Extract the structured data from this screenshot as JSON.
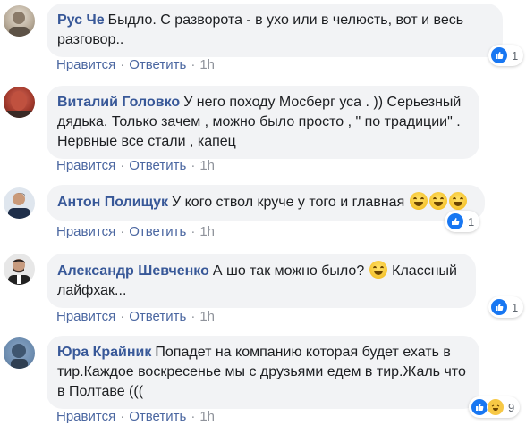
{
  "comments": [
    {
      "author": "Рус Че",
      "text": "Быдло. С разворота - в ухо или в челюсть, вот и весь разговор..",
      "time": "1h",
      "reactions": "1"
    },
    {
      "author": "Виталий Головко",
      "text": "У него походу Мосберг уса . )) Серьезный дядька. Только зачем , можно было просто , \" по традиции\" . Нервные все стали , капец",
      "time": "1h",
      "reactions": ""
    },
    {
      "author": "Антон Полищук",
      "text": "У кого ствол круче у того и главная",
      "time": "1h",
      "reactions": "1"
    },
    {
      "author": "Александр Шевченко",
      "text": "А шо так можно было?",
      "text2": "Классный лайфхак...",
      "time": "1h",
      "reactions": "1"
    },
    {
      "author": "Юра Крайник",
      "text": "Попадет на компанию которая будет ехать в тир.Каждое воскресенье мы с друзьями едем в тир.Жаль что в Полтаве (((",
      "time": "1h",
      "reactions": "9"
    }
  ],
  "labels": {
    "like": "Нравится",
    "reply": "Ответить",
    "separator": "·"
  },
  "colors": {
    "author": "#385898",
    "bubble": "#f2f3f5",
    "like_blue": "#1877f2"
  }
}
